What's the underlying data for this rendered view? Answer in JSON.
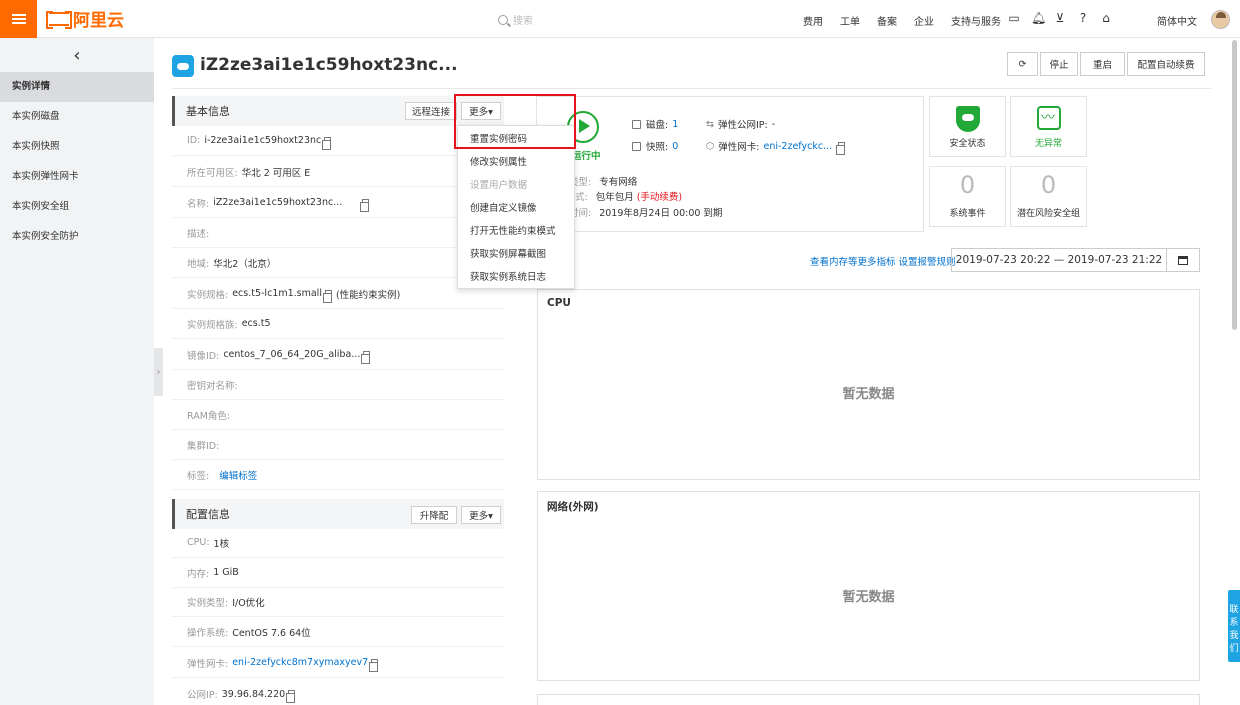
{
  "topbar": {
    "search_placeholder": "搜索",
    "nav": [
      "费用",
      "工单",
      "备案",
      "企业",
      "支持与服务"
    ],
    "icons": [
      "terminal-icon",
      "bell-icon",
      "cart-icon",
      "help-icon",
      "home-icon"
    ],
    "lang": "简体中文",
    "logo_text": "阿里云"
  },
  "sidebar": {
    "items": [
      {
        "label": "实例详情",
        "active": true
      },
      {
        "label": "本实例磁盘"
      },
      {
        "label": "本实例快照"
      },
      {
        "label": "本实例弹性网卡"
      },
      {
        "label": "本实例安全组"
      },
      {
        "label": "本实例安全防护"
      }
    ]
  },
  "header": {
    "title": "iZ2ze3ai1e1c59hoxt23nc...",
    "buttons": [
      "停止",
      "重启",
      "配置自动续费"
    ]
  },
  "basic": {
    "title": "基本信息",
    "remote_btn": "远程连接",
    "more_btn": "更多▾",
    "rows": [
      {
        "k": "ID:",
        "v": "i-2ze3ai1e1c59hoxt23nc"
      },
      {
        "k": "所在可用区:",
        "v": "华北 2 可用区 E"
      },
      {
        "k": "名称:",
        "v": "iZ2ze3ai1e1c59hoxt23nc..."
      },
      {
        "k": "描述:",
        "v": ""
      },
      {
        "k": "地域:",
        "v": "华北2（北京）"
      },
      {
        "k": "实例规格:",
        "v": "ecs.t5-lc1m1.small",
        "extra": "(性能约束实例)"
      },
      {
        "k": "实例规格族:",
        "v": "ecs.t5"
      },
      {
        "k": "镜像ID:",
        "v": "centos_7_06_64_20G_aliba..."
      },
      {
        "k": "密钥对名称:",
        "v": ""
      },
      {
        "k": "RAM角色:",
        "v": ""
      },
      {
        "k": "集群ID:",
        "v": ""
      },
      {
        "k": "标签:",
        "v": "编辑标签"
      }
    ]
  },
  "config": {
    "title": "配置信息",
    "upgrade_btn": "升降配",
    "more_btn": "更多▾",
    "rows": [
      {
        "k": "CPU:",
        "v": "1核"
      },
      {
        "k": "内存:",
        "v": "1 GiB"
      },
      {
        "k": "实例类型:",
        "v": "I/O优化"
      },
      {
        "k": "操作系统:",
        "v": "CentOS 7.6 64位"
      },
      {
        "k": "弹性网卡:",
        "v": "eni-2zefyckc8m7xymaxyev7"
      },
      {
        "k": "公网IP:",
        "v": "39.96.84.220"
      }
    ]
  },
  "dropdown": {
    "items": [
      {
        "label": "重置实例密码",
        "disabled": false
      },
      {
        "label": "修改实例属性",
        "disabled": false
      },
      {
        "label": "设置用户数据",
        "disabled": true
      },
      {
        "label": "创建自定义镜像",
        "disabled": false
      },
      {
        "label": "打开无性能约束模式",
        "disabled": false
      },
      {
        "label": "获取实例屏幕截图",
        "disabled": false
      },
      {
        "label": "获取实例系统日志",
        "disabled": false
      }
    ]
  },
  "status": {
    "run_text": "运行中",
    "disk_k": "磁盘:",
    "disk_v": "1",
    "snap_k": "快照:",
    "snap_v": "0",
    "eip_k": "弹性公网IP:",
    "eip_v": "-",
    "eni_k": "弹性网卡:",
    "eni_v": "eni-2zefyckc...",
    "net_k": "类型:",
    "net_v": "专有网络",
    "pay_k": "式:",
    "pay_v": "包年包月",
    "pay_red": "(手动续费)",
    "exp_k": "时间:",
    "exp_v": "2019年8月24日 00:00 到期"
  },
  "cards": {
    "security": "安全状态",
    "normal": "无异常",
    "events_num": "0",
    "events": "系统事件",
    "risk_num": "0",
    "risk": "潜在风险安全组"
  },
  "monitor": {
    "title": "控",
    "links": "查看内存等更多指标 设置报警规则",
    "date_range": "2019-07-23 20:22  —  2019-07-23 21:22",
    "charts": [
      {
        "title": "CPU",
        "empty": "暂无数据"
      },
      {
        "title": "网络(外网)",
        "empty": "暂无数据"
      }
    ]
  },
  "contact": "联系我们"
}
